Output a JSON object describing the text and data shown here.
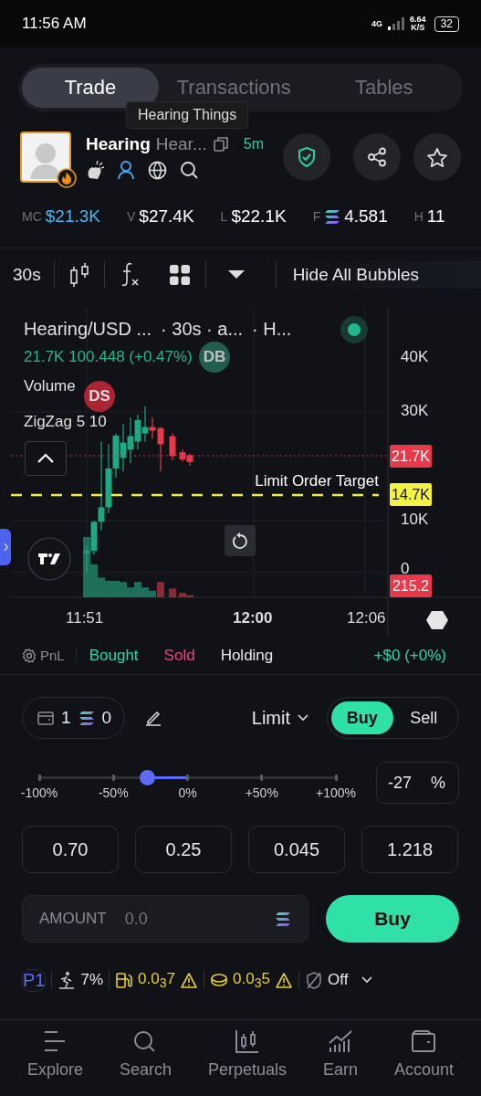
{
  "status_bar": {
    "time": "11:56 AM",
    "network": "4G",
    "speed": "6.64",
    "speed_unit": "K/S",
    "battery": "32"
  },
  "tabs": [
    {
      "label": "Trade",
      "selected": true
    },
    {
      "label": "Transactions",
      "selected": false
    },
    {
      "label": "Tables",
      "selected": false
    }
  ],
  "tooltip": "Hearing Things",
  "token": {
    "name": "Hearing",
    "ticker": "Hear...",
    "age": "5m"
  },
  "stats": [
    {
      "label": "MC",
      "value": "$21.3K",
      "kind": "highlight"
    },
    {
      "label": "V",
      "value": "$27.4K",
      "kind": "plain"
    },
    {
      "label": "L",
      "value": "$22.1K",
      "kind": "plain"
    },
    {
      "label": "F",
      "value": "4.581",
      "kind": "sol"
    },
    {
      "label": "H",
      "value": "11",
      "kind": "plain"
    }
  ],
  "toolbar": {
    "interval": "30s",
    "bubbles": "Hide All Bubbles"
  },
  "chart": {
    "legend": [
      "Hearing/USD ...",
      "· 30s · a...",
      "· H..."
    ],
    "legend_price": "21.7K 100.448 (+0.47%)",
    "indicators": [
      "Volume",
      "ZigZag 5 10"
    ],
    "bubbles": [
      {
        "label": "DB",
        "kind": "buy"
      },
      {
        "label": "DS",
        "kind": "sell"
      }
    ],
    "y_labels": [
      "40K",
      "30K",
      "10K",
      "0"
    ],
    "price_tags": [
      {
        "value": "21.7K",
        "kind": "price"
      },
      {
        "value": "14.7K",
        "kind": "limit"
      },
      {
        "value": "215.2",
        "kind": "volume"
      }
    ],
    "limit_label": "Limit Order Target",
    "x_labels": [
      {
        "label": "11:51",
        "bold": false
      },
      {
        "label": "12:00",
        "bold": true
      },
      {
        "label": "12:06",
        "bold": false
      }
    ]
  },
  "pnl": {
    "settings": "PnL",
    "bought": "Bought",
    "sold": "Sold",
    "holding": "Holding",
    "result": "+$0 (+0%)"
  },
  "order": {
    "wallets": "1",
    "balance": "0",
    "type": "Limit",
    "sides": [
      {
        "label": "Buy",
        "selected": true
      },
      {
        "label": "Sell",
        "selected": false
      }
    ],
    "slider": {
      "level": 0.365,
      "marks": [
        "-100%",
        "-50%",
        "0%",
        "+50%",
        "+100%"
      ]
    },
    "percent": "-27",
    "percent_unit": "%",
    "presets": [
      "0.70",
      "0.25",
      "0.045",
      "1.218"
    ],
    "amount_label": "AMOUNT",
    "amount_placeholder": "0.0",
    "submit": "Buy"
  },
  "settings_row": [
    {
      "kind": "preset",
      "text": "P1"
    },
    {
      "kind": "slippage",
      "text": "7%"
    },
    {
      "kind": "gas",
      "text": "0.0$_{3}$7",
      "warning": true
    },
    {
      "kind": "tip",
      "text": "0.0$_{3}$5",
      "warning": true
    },
    {
      "kind": "mev",
      "text": "Off"
    }
  ],
  "nav": [
    {
      "label": "Explore"
    },
    {
      "label": "Search"
    },
    {
      "label": "Perpetuals"
    },
    {
      "label": "Earn"
    },
    {
      "label": "Account"
    }
  ]
}
